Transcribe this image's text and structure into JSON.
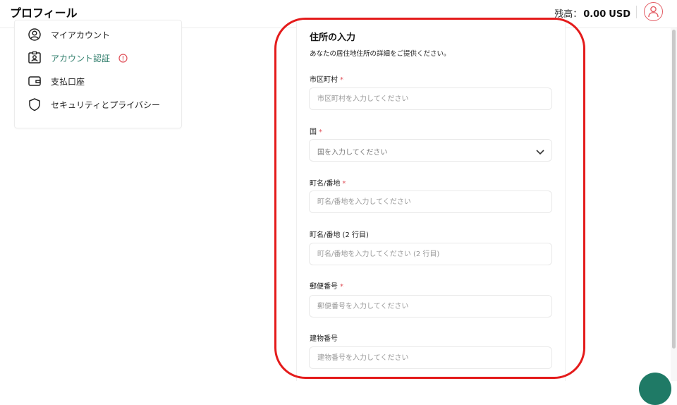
{
  "header": {
    "title": "プロフィール",
    "balance_label": "残高：",
    "balance_amount": "0.00",
    "balance_currency": "USD",
    "avatar_icon": "user-circle-icon"
  },
  "sidebar": {
    "items": [
      {
        "label": "マイアカウント",
        "icon": "user-circle-icon"
      },
      {
        "label": "アカウント認証",
        "icon": "id-card-icon",
        "active": true,
        "alert_icon": "alert-circle-icon"
      },
      {
        "label": "支払口座",
        "icon": "wallet-icon"
      },
      {
        "label": "セキュリティとプライバシー",
        "icon": "shield-icon"
      }
    ]
  },
  "form": {
    "title": "住所の入力",
    "subtitle": "あなたの居住地住所の詳細をご提供ください。",
    "fields": [
      {
        "label": "市区町村",
        "required": true,
        "placeholder": "市区町村を入力してください",
        "type": "text"
      },
      {
        "label": "国",
        "required": true,
        "placeholder": "国を入力してください",
        "type": "select"
      },
      {
        "label": "町名/番地",
        "required": true,
        "placeholder": "町名/番地を入力してください",
        "type": "text"
      },
      {
        "label": "町名/番地 (2 行目)",
        "required": false,
        "placeholder": "町名/番地を入力してください (2 行目)",
        "type": "text"
      },
      {
        "label": "郵便番号",
        "required": true,
        "placeholder": "郵便番号を入力してください",
        "type": "text"
      },
      {
        "label": "建物番号",
        "required": false,
        "placeholder": "建物番号を入力してください",
        "type": "text"
      }
    ],
    "required_mark": "*"
  },
  "colors": {
    "accent": "#2f7d6b",
    "required": "#e0515a",
    "highlight": "#e41b1b",
    "fab": "#1f7a66"
  }
}
